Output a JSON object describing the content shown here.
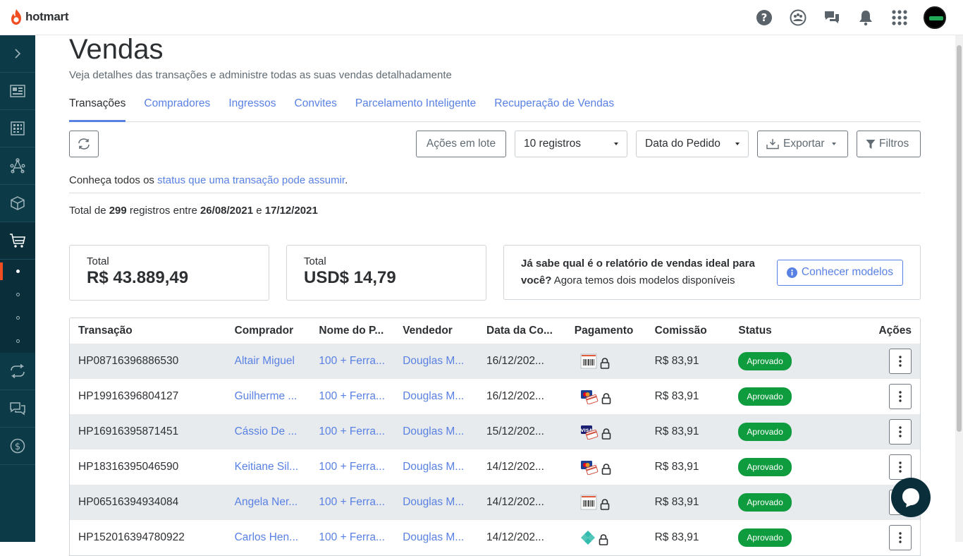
{
  "brand": {
    "name": "hotmart",
    "accent": "#ef4e23"
  },
  "header": {
    "icons": [
      "help-icon",
      "community-icon",
      "chat-icon",
      "bell-icon",
      "apps-grid-icon",
      "avatar"
    ]
  },
  "page": {
    "title": "Vendas",
    "subtitle": "Veja detalhes das transações e administre todas as suas vendas detalhadamente"
  },
  "tabs": [
    {
      "label": "Transações",
      "active": true
    },
    {
      "label": "Compradores"
    },
    {
      "label": "Ingressos"
    },
    {
      "label": "Convites"
    },
    {
      "label": "Parcelamento Inteligente"
    },
    {
      "label": "Recuperação de Vendas"
    }
  ],
  "toolbar": {
    "bulk_actions": "Ações em lote",
    "records_select": "10 registros",
    "date_select": "Data do Pedido",
    "export": "Exportar",
    "filters": "Filtros"
  },
  "info": {
    "prefix": "Conheça todos os ",
    "link": "status que uma transação pode assumir",
    "suffix": "."
  },
  "totals": {
    "prefix": "Total de ",
    "count": "299",
    "middle": " registros entre ",
    "start_date": "26/08/2021",
    "and": " e ",
    "end_date": "17/12/2021"
  },
  "cards": {
    "brl_label": "Total",
    "brl_value": "R$ 43.889,49",
    "usd_label": "Total",
    "usd_value": "USD$ 14,79",
    "promo_bold": "Já sabe qual é o relatório de vendas ideal para você?",
    "promo_rest": " Agora temos dois modelos disponíveis",
    "promo_button": "Conhecer modelos"
  },
  "table": {
    "headers": [
      "Transação",
      "Comprador",
      "Nome do P...",
      "Vendedor",
      "Data da Co...",
      "Pagamento",
      "Comissão",
      "Status",
      "Ações"
    ],
    "rows": [
      {
        "id": "HP08716396886530",
        "buyer": "Altair Miguel",
        "product": "100 + Ferra...",
        "seller": "Douglas M...",
        "date": "16/12/202...",
        "pay": "boleto",
        "commission": "R$ 83,91",
        "status": "Aprovado"
      },
      {
        "id": "HP19916396804127",
        "buyer": "Guilherme ...",
        "product": "100 + Ferra...",
        "seller": "Douglas M...",
        "date": "16/12/202...",
        "pay": "mastercard",
        "commission": "R$ 83,91",
        "status": "Aprovado"
      },
      {
        "id": "HP16916395871451",
        "buyer": "Cássio De ...",
        "product": "100 + Ferra...",
        "seller": "Douglas M...",
        "date": "15/12/202...",
        "pay": "visa",
        "commission": "R$ 83,91",
        "status": "Aprovado"
      },
      {
        "id": "HP18316395046590",
        "buyer": "Keitiane Sil...",
        "product": "100 + Ferra...",
        "seller": "Douglas M...",
        "date": "14/12/202...",
        "pay": "mastercard",
        "commission": "R$ 83,91",
        "status": "Aprovado"
      },
      {
        "id": "HP06516394934084",
        "buyer": "Angela Ner...",
        "product": "100 + Ferra...",
        "seller": "Douglas M...",
        "date": "14/12/202...",
        "pay": "boleto",
        "commission": "R$ 83,91",
        "status": "Aprovado"
      },
      {
        "id": "HP152016394780922",
        "buyer": "Carlos Hen...",
        "product": "100 + Ferra...",
        "seller": "Douglas M...",
        "date": "14/12/202...",
        "pay": "pix",
        "commission": "R$ 83,91",
        "status": "Aprovado"
      }
    ]
  },
  "colors": {
    "sidebar": "#0d3a47",
    "link": "#5981e3",
    "approved": "#0e9c3e"
  }
}
